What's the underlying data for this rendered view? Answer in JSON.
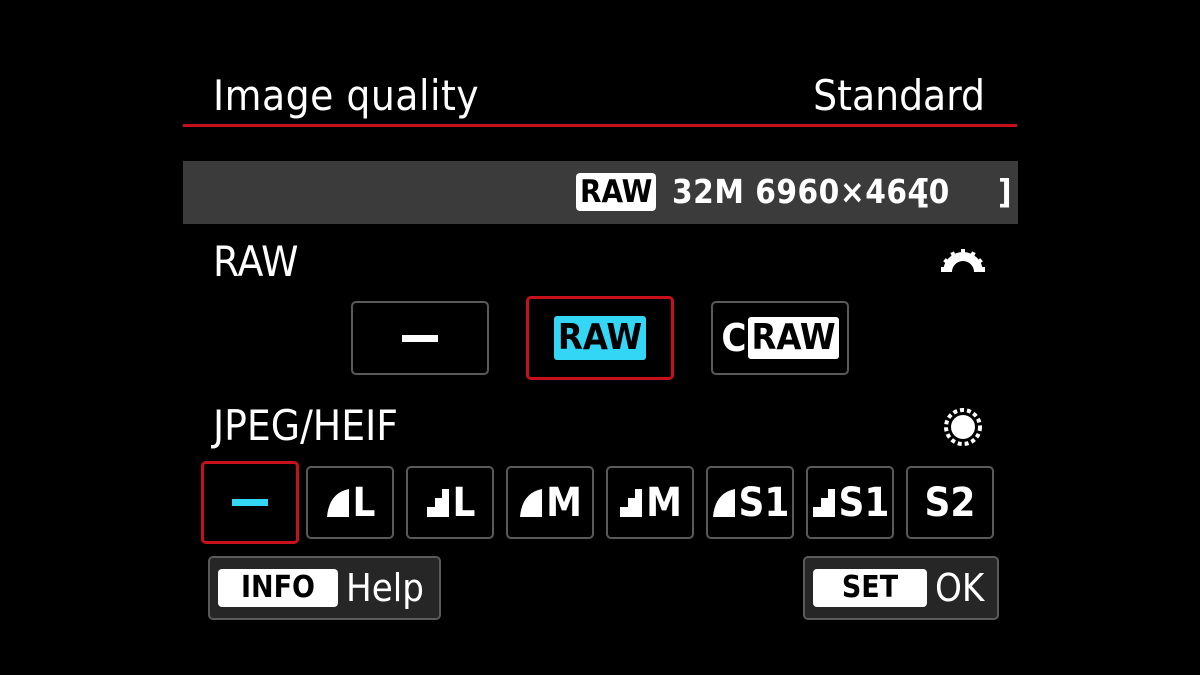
{
  "header": {
    "title": "Image quality",
    "mode": "Standard"
  },
  "info_bar": {
    "format_badge": "RAW",
    "resolution": "32M 6960×4640",
    "shots_remaining": "",
    "bracket_open": "[",
    "bracket_close": "]"
  },
  "raw_section": {
    "label": "RAW",
    "dial_icon": "main-dial-icon",
    "options": [
      {
        "id": "none",
        "label": "—",
        "selected": false
      },
      {
        "id": "raw",
        "label": "RAW",
        "selected": true
      },
      {
        "id": "craw",
        "prefix": "C",
        "label": "RAW",
        "selected": false
      }
    ]
  },
  "jpeg_section": {
    "label": "JPEG/HEIF",
    "dial_icon": "quick-control-dial-icon",
    "options": [
      {
        "id": "none",
        "label": "—",
        "selected": true
      },
      {
        "id": "fine-l",
        "label": "L",
        "icon": "fine-quality-icon"
      },
      {
        "id": "normal-l",
        "label": "L",
        "icon": "normal-quality-icon"
      },
      {
        "id": "fine-m",
        "label": "M",
        "icon": "fine-quality-icon"
      },
      {
        "id": "normal-m",
        "label": "M",
        "icon": "normal-quality-icon"
      },
      {
        "id": "fine-s1",
        "label": "S1",
        "icon": "fine-quality-icon"
      },
      {
        "id": "normal-s1",
        "label": "S1",
        "icon": "normal-quality-icon"
      },
      {
        "id": "s2",
        "label": "S2"
      }
    ]
  },
  "footer": {
    "help_key": "INFO",
    "help_label": "Help",
    "ok_key": "SET",
    "ok_label": "OK"
  },
  "colors": {
    "accent_red": "#c8101c",
    "selected_cyan": "#33d6f5",
    "bar_gray": "#3b3b3b"
  }
}
